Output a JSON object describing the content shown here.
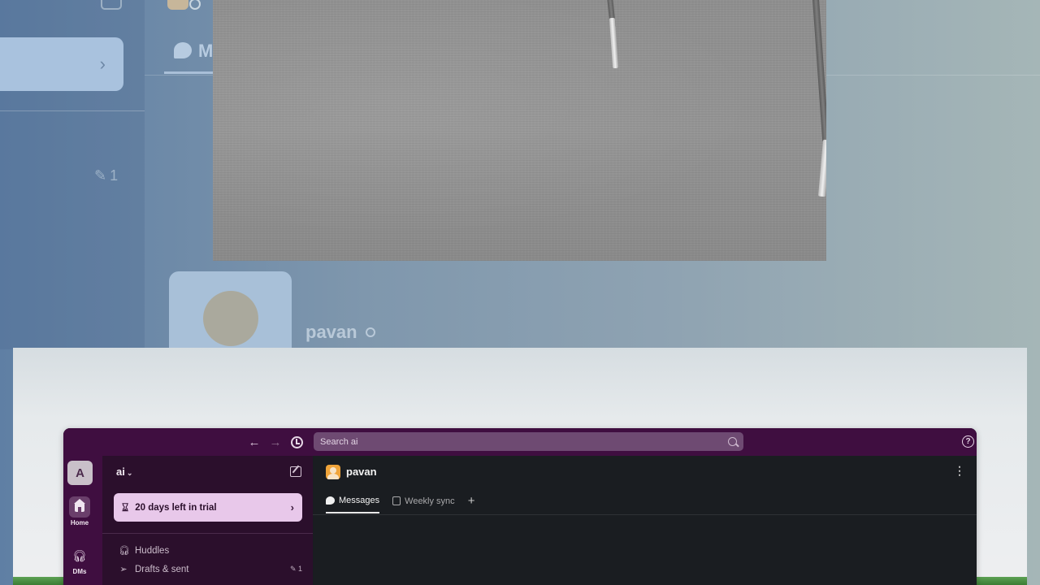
{
  "background": {
    "sidebar_count": "1",
    "tab_label": "M",
    "user_name": "pavan"
  },
  "titlebar": {
    "search_placeholder": "Search ai"
  },
  "rail": {
    "workspace_initial": "A",
    "items": [
      {
        "label": "Home",
        "icon": "home-icon",
        "active": true
      },
      {
        "label": "DMs",
        "icon": "headphones-icon",
        "active": false
      }
    ]
  },
  "sidebar": {
    "workspace_name": "ai",
    "trial_label": "20 days left in trial",
    "items": [
      {
        "label": "Huddles",
        "icon": "headphones-icon",
        "count": ""
      },
      {
        "label": "Drafts & sent",
        "icon": "send-icon",
        "count": "1"
      }
    ]
  },
  "main": {
    "channel_name": "pavan",
    "tabs": [
      {
        "label": "Messages",
        "active": true
      },
      {
        "label": "Weekly sync",
        "active": false
      }
    ]
  },
  "colors": {
    "aubergine": "#3f0e40",
    "sidebar": "#2b0f2c",
    "trial_banner": "#e8c8ea",
    "main_bg": "#1a1d21"
  }
}
